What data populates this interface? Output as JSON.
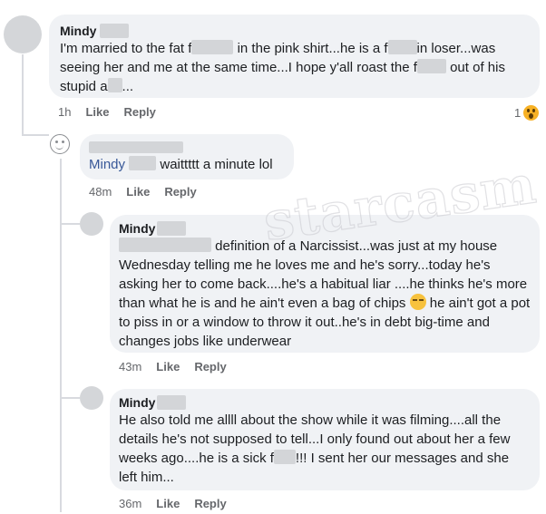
{
  "watermark": "starcasm",
  "comments": [
    {
      "author": "Mindy",
      "text_parts": [
        "I'm married to the fat f",
        " in the pink shirt...he is a f",
        "in loser...was seeing her and me at the same time...I hope y'all roast the f",
        " out of his stupid a",
        "..."
      ],
      "time": "1h",
      "like": "Like",
      "reply": "Reply",
      "reaction_count": "1"
    },
    {
      "mention": "Mindy",
      "text": "waittttt a minute lol",
      "time": "48m",
      "like": "Like",
      "reply": "Reply"
    },
    {
      "author": "Mindy",
      "text_parts": [
        "definition of a Narcissist...was just at my house Wednesday telling me he loves me and he's sorry...today he's asking her to come back....he's a habitual liar ....he thinks he's more than what he is and he ain't even a bag of chips",
        " he ain't got a pot to piss in or a window to throw it out..he's in debt big-time and changes jobs like underwear"
      ],
      "time": "43m",
      "like": "Like",
      "reply": "Reply"
    },
    {
      "author": "Mindy",
      "text_parts": [
        "He also told me allll about the show while it was filming....all the details he's not supposed to tell...I only found out about her a few weeks ago....he is a sick f",
        "!!! I sent her our messages and she left him..."
      ],
      "time": "36m",
      "like": "Like",
      "reply": "Reply"
    }
  ],
  "colors": {
    "bubble": "#f0f2f5",
    "mention": "#385898",
    "meta": "#65676b"
  },
  "icons": [
    "wow-reaction-icon",
    "smirk-emoji-icon",
    "reply-indicator-face-icon"
  ]
}
